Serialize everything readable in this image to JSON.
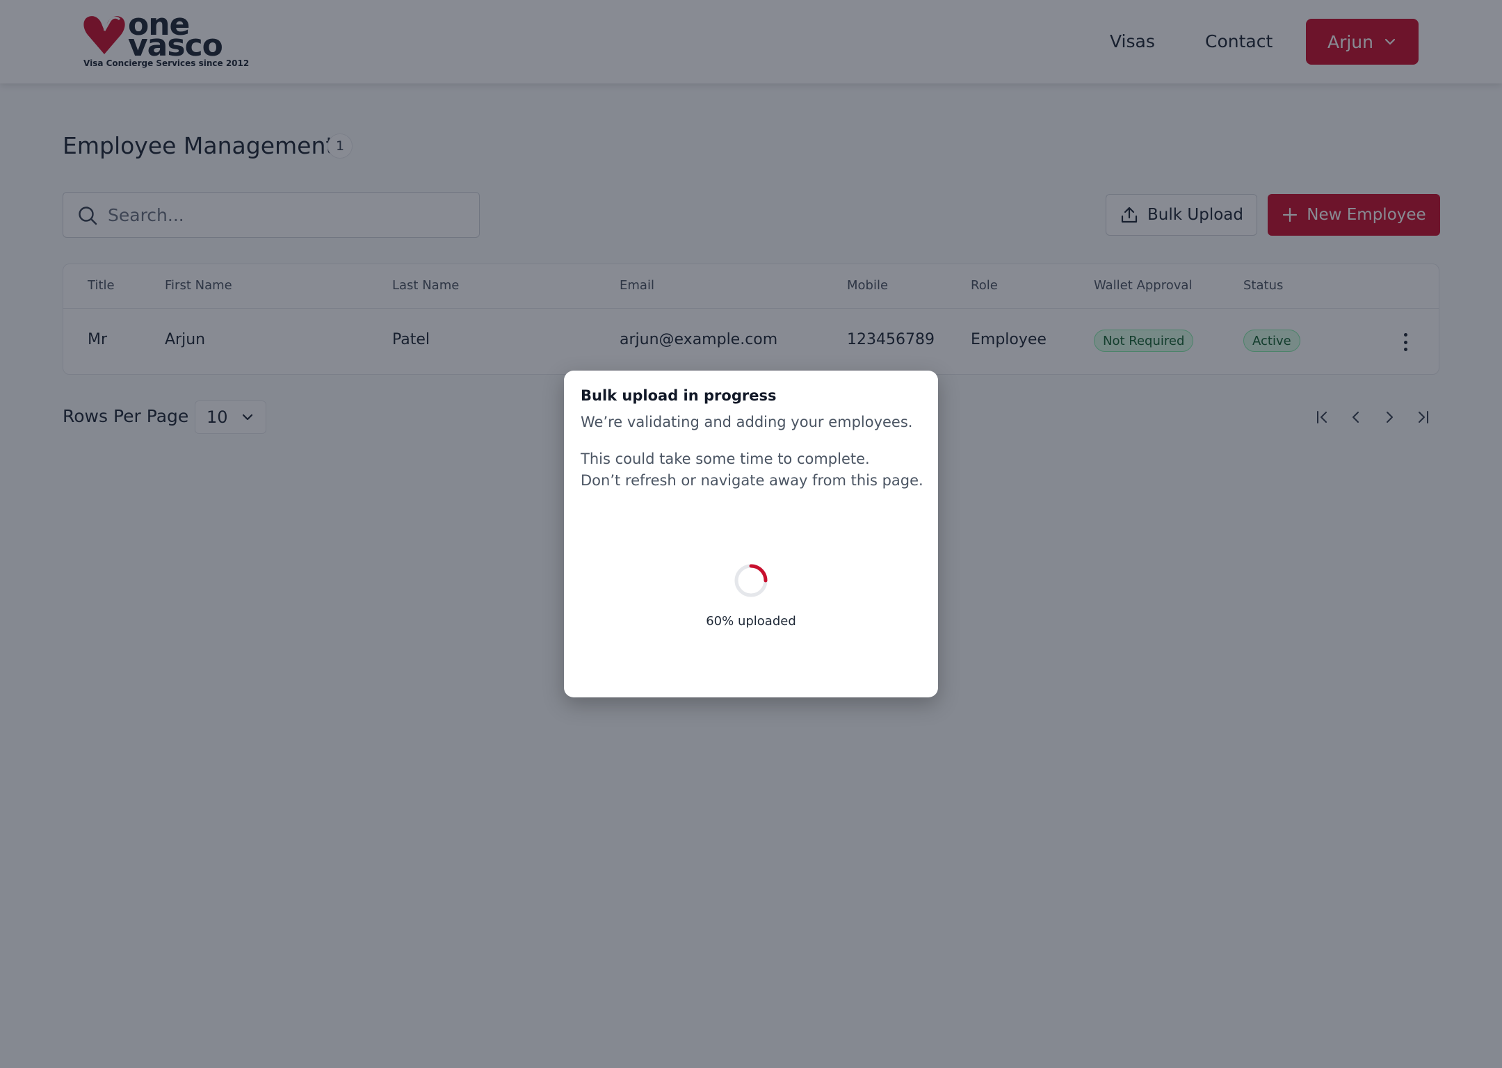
{
  "brand": {
    "word_top": "one",
    "word_bottom": "vasco",
    "tagline": "Visa Concierge Services since 2012",
    "primary_color": "#c8102e"
  },
  "nav": {
    "visas": "Visas",
    "contact": "Contact",
    "user_name": "Arjun"
  },
  "page": {
    "title": "Employee Management",
    "count": "1"
  },
  "search": {
    "placeholder": "Search...",
    "value": ""
  },
  "actions": {
    "bulk_upload": "Bulk Upload",
    "new_employee": "New Employee"
  },
  "table": {
    "headers": [
      "Title",
      "First Name",
      "Last Name",
      "Email",
      "Mobile",
      "Role",
      "Wallet Approval",
      "Status"
    ],
    "rows": [
      {
        "title": "Mr",
        "first_name": "Arjun",
        "last_name": "Patel",
        "email": "arjun@example.com",
        "mobile": "123456789",
        "role": "Employee",
        "wallet_approval": "Not Required",
        "status": "Active"
      }
    ]
  },
  "pagination": {
    "rows_per_page_label": "Rows Per Page",
    "rows_per_page_value": "10"
  },
  "modal": {
    "title": "Bulk upload in progress",
    "subtitle": "We’re validating and adding your employees.",
    "note_line1": "This could take some time to complete.",
    "note_line2": "Don’t refresh or navigate away from this page.",
    "progress_percent": 60,
    "progress_text": "60% uploaded"
  }
}
